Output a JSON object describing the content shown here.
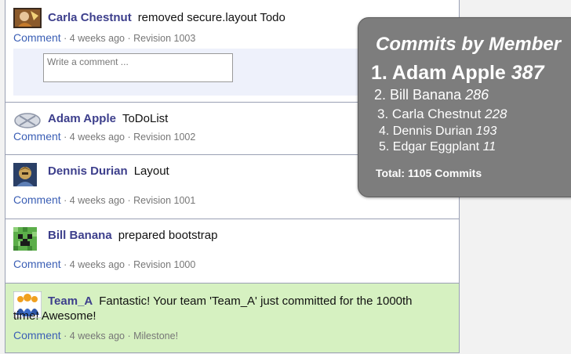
{
  "feed": {
    "items": [
      {
        "author": "Carla Chestnut",
        "text": "removed secure.layout Todo",
        "comment": "Comment",
        "time": "4 weeks ago",
        "tag": "Revision 1003",
        "avatar": "carla-avatar-icon"
      },
      {
        "author": "Adam Apple",
        "text": "ToDoList",
        "comment": "Comment",
        "time": "4 weeks ago",
        "tag": "Revision 1002",
        "avatar": "adam-avatar-icon"
      },
      {
        "author": "Dennis Durian",
        "text": "Layout",
        "comment": "Comment",
        "time": "4 weeks ago",
        "tag": "Revision 1001",
        "avatar": "dennis-avatar-icon"
      },
      {
        "author": "Bill Banana",
        "text": "prepared bootstrap",
        "comment": "Comment",
        "time": "4 weeks ago",
        "tag": "Revision 1000",
        "avatar": "bill-avatar-icon"
      },
      {
        "author": "Team_A",
        "text_line1": "Fantastic! Your team 'Team_A' just committed for the 1000th",
        "text_line2": "time! Awesome!",
        "comment": "Comment",
        "time": "4 weeks ago",
        "tag": "Milestone!",
        "avatar": "team-avatar-icon"
      }
    ],
    "comment_placeholder": "Write a comment ...",
    "separator": " · "
  },
  "stats": {
    "title": "Commits by Member",
    "ranking": [
      {
        "rank": "1.",
        "name": "Adam Apple",
        "count": "387"
      },
      {
        "rank": "2.",
        "name": "Bill Banana",
        "count": "286"
      },
      {
        "rank": "3.",
        "name": "Carla Chestnut",
        "count": "228"
      },
      {
        "rank": "4.",
        "name": "Dennis Durian",
        "count": "193"
      },
      {
        "rank": "5.",
        "name": "Edgar Eggplant",
        "count": "11"
      }
    ],
    "total": "Total: 1105 Commits"
  },
  "colors": {
    "author": "#3d3f8c",
    "link": "#3b5fb5",
    "milestone_bg": "#d6f1c1",
    "stats_bg": "#7d7d7d"
  }
}
